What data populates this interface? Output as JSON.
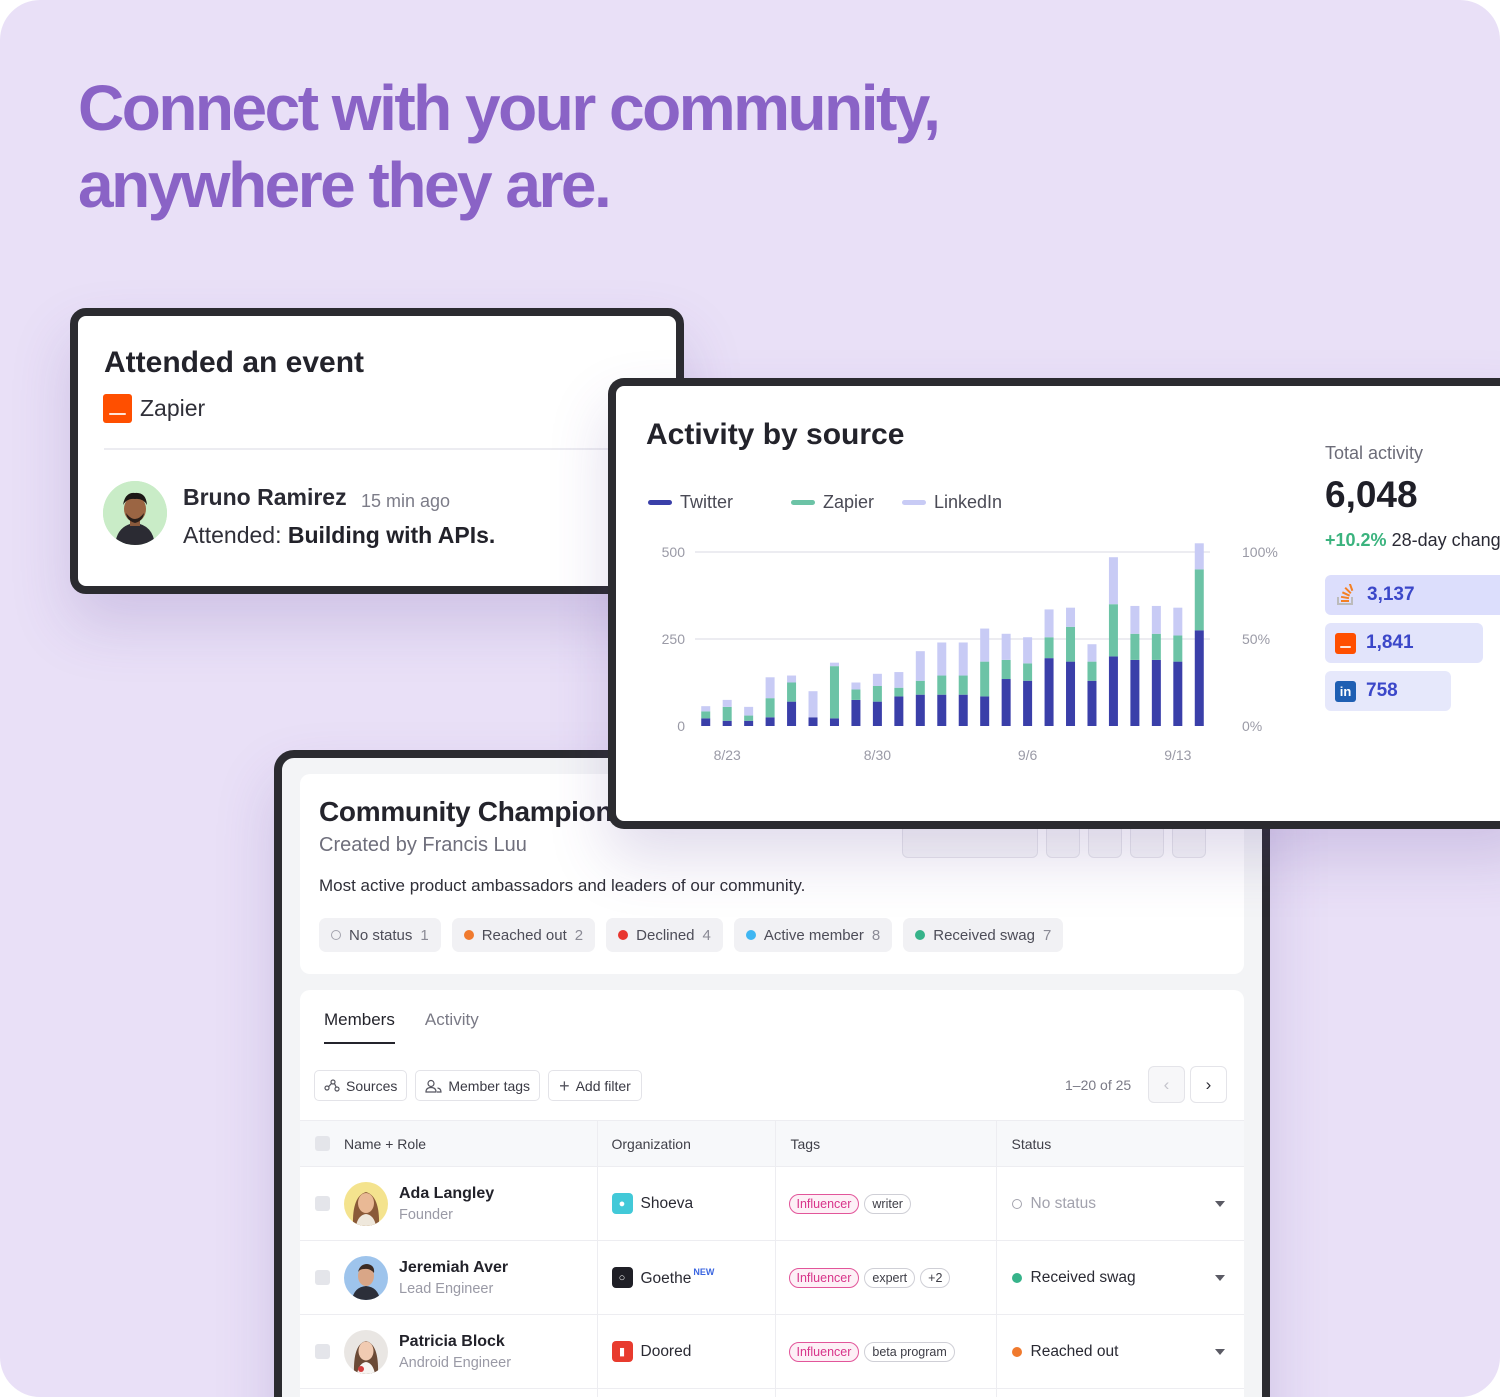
{
  "headline": {
    "line1": "Connect with your community,",
    "line2": "anywhere they are."
  },
  "event_card": {
    "title": "Attended an event",
    "source": "Zapier",
    "source_icon": "zapier-icon",
    "person": "Bruno Ramirez",
    "time": "15 min ago",
    "action_prefix": "Attended:",
    "event_name": "Building with APIs."
  },
  "activity_card": {
    "title": "Activity by source",
    "legend": [
      {
        "name": "Twitter",
        "color": "#3a3fa9"
      },
      {
        "name": "Zapier",
        "color": "#6cc3a6"
      },
      {
        "name": "LinkedIn",
        "color": "#c8cbf5"
      }
    ],
    "total_label": "Total activity",
    "total_value": "6,048",
    "change_pct": "+10.2%",
    "change_label": "28-day change",
    "sources": [
      {
        "icon": "stackoverflow-icon",
        "value": "3,137"
      },
      {
        "icon": "zapier-icon",
        "value": "1,841"
      },
      {
        "icon": "linkedin-icon",
        "value": "758"
      }
    ]
  },
  "chart_data": {
    "type": "bar",
    "stacked": true,
    "categories": [
      "8/22",
      "8/23",
      "8/24",
      "8/25",
      "8/26",
      "8/27",
      "8/28",
      "8/29",
      "8/30",
      "8/31",
      "9/1",
      "9/2",
      "9/3",
      "9/4",
      "9/5",
      "9/6",
      "9/7",
      "9/8",
      "9/9",
      "9/10",
      "9/11",
      "9/12",
      "9/13",
      "9/14"
    ],
    "x_tick_labels": [
      "8/23",
      "8/30",
      "9/6",
      "9/13"
    ],
    "series": [
      {
        "name": "Twitter",
        "values": [
          22,
          15,
          15,
          25,
          70,
          25,
          22,
          75,
          70,
          85,
          90,
          90,
          90,
          85,
          135,
          130,
          195,
          185,
          130,
          200,
          190,
          190,
          185,
          275
        ]
      },
      {
        "name": "Zapier",
        "values": [
          20,
          40,
          15,
          55,
          55,
          0,
          150,
          30,
          45,
          25,
          40,
          55,
          55,
          100,
          55,
          50,
          60,
          100,
          55,
          150,
          75,
          75,
          75,
          175
        ]
      },
      {
        "name": "LinkedIn",
        "values": [
          15,
          20,
          25,
          60,
          20,
          75,
          10,
          20,
          35,
          45,
          85,
          95,
          95,
          95,
          75,
          75,
          80,
          55,
          50,
          135,
          80,
          80,
          80,
          75
        ]
      }
    ],
    "yticks_left": [
      "0",
      "250",
      "500"
    ],
    "yticks_right": [
      "0%",
      "50%",
      "100%"
    ],
    "ylim": [
      0,
      500
    ],
    "grid": true,
    "legend_position": "top-left"
  },
  "community_card": {
    "title": "Community Champions",
    "creator": "Created by Francis Luu",
    "description": "Most active product ambassadors and leaders of our community.",
    "statuses": [
      {
        "label": "No status",
        "count": "1",
        "color": "hollow"
      },
      {
        "label": "Reached out",
        "count": "2",
        "color": "#f07a2e"
      },
      {
        "label": "Declined",
        "count": "4",
        "color": "#e8352e"
      },
      {
        "label": "Active member",
        "count": "8",
        "color": "#3fb6f2"
      },
      {
        "label": "Received swag",
        "count": "7",
        "color": "#36b38a"
      }
    ],
    "tabs": [
      "Members",
      "Activity"
    ],
    "filters": [
      {
        "label": "Sources",
        "icon": "sources-icon"
      },
      {
        "label": "Member tags",
        "icon": "people-icon"
      },
      {
        "label": "Add filter",
        "icon": "plus-icon"
      }
    ],
    "pagination": "1–20 of 25",
    "columns": [
      "Name + Role",
      "Organization",
      "Tags",
      "Status"
    ],
    "rows": [
      {
        "name": "Ada Langley",
        "role": "Founder",
        "org": "Shoeva",
        "org_badge": "",
        "org_color": "#42c9d8",
        "tags": [
          "Influencer",
          "writer"
        ],
        "status": "No status",
        "status_color": "hollow"
      },
      {
        "name": "Jeremiah Aver",
        "role": "Lead Engineer",
        "org": "Goethe",
        "org_badge": "NEW",
        "org_color": "#1f1f26",
        "tags": [
          "Influencer",
          "expert",
          "+2"
        ],
        "status": "Received swag",
        "status_color": "#36b38a"
      },
      {
        "name": "Patricia Block",
        "role": "Android Engineer",
        "org": "Doored",
        "org_badge": "",
        "org_color": "#e83b2e",
        "tags": [
          "Influencer",
          "beta program"
        ],
        "status": "Reached out",
        "status_color": "#f07a2e"
      }
    ]
  }
}
